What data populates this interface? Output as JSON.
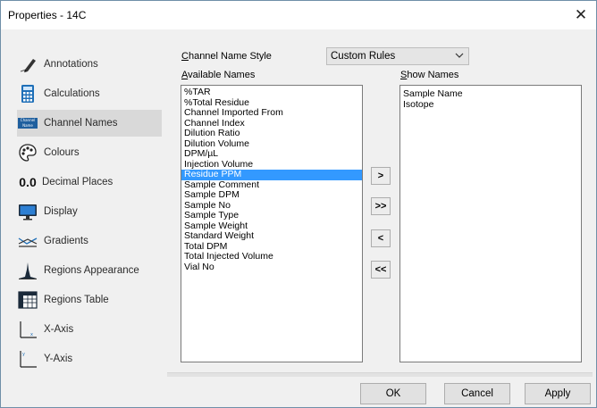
{
  "window": {
    "title": "Properties - 14C",
    "close_glyph": "✕"
  },
  "sidebar": {
    "items": [
      {
        "label": "Annotations",
        "icon": "pen-icon"
      },
      {
        "label": "Calculations",
        "icon": "calculator-icon"
      },
      {
        "label": "Channel Names",
        "icon": "channel-name-icon",
        "selected": true
      },
      {
        "label": "Colours",
        "icon": "palette-icon"
      },
      {
        "label": "Decimal Places",
        "icon": "decimal-icon",
        "icon_text": "0.0"
      },
      {
        "label": "Display",
        "icon": "monitor-icon"
      },
      {
        "label": "Gradients",
        "icon": "gradient-icon"
      },
      {
        "label": "Regions Appearance",
        "icon": "peak-icon"
      },
      {
        "label": "Regions Table",
        "icon": "table-icon"
      },
      {
        "label": "X-Axis",
        "icon": "x-axis-icon"
      },
      {
        "label": "Y-Axis",
        "icon": "y-axis-icon"
      }
    ],
    "channel_icon_text": "Channel Name"
  },
  "channel_name_style": {
    "label_prefix": "C",
    "label_rest": "hannel Name Style",
    "value": "Custom Rules"
  },
  "available_names": {
    "label_prefix": "A",
    "label_rest": "vailable Names",
    "items": [
      "%TAR",
      "%Total Residue",
      "Channel Imported From",
      "Channel Index",
      "Dilution Ratio",
      "Dilution Volume",
      "DPM/µL",
      "Injection Volume",
      "Residue PPM",
      "Sample Comment",
      "Sample DPM",
      "Sample No",
      "Sample Type",
      "Sample Weight",
      "Standard Weight",
      "Total DPM",
      "Total Injected Volume",
      "Vial No"
    ],
    "selected": "Residue PPM"
  },
  "show_names": {
    "label_prefix": "S",
    "label_rest": "how Names",
    "items": [
      "Sample Name",
      "Isotope"
    ]
  },
  "move_buttons": {
    "add": ">",
    "add_all": ">>",
    "remove": "<",
    "remove_all": "<<"
  },
  "buttons": {
    "ok": "OK",
    "cancel": "Cancel",
    "apply": "Apply"
  },
  "colors": {
    "selection": "#3399ff",
    "sidebar_selected": "#d9d9d9",
    "client_bg": "#f0f0f0"
  }
}
